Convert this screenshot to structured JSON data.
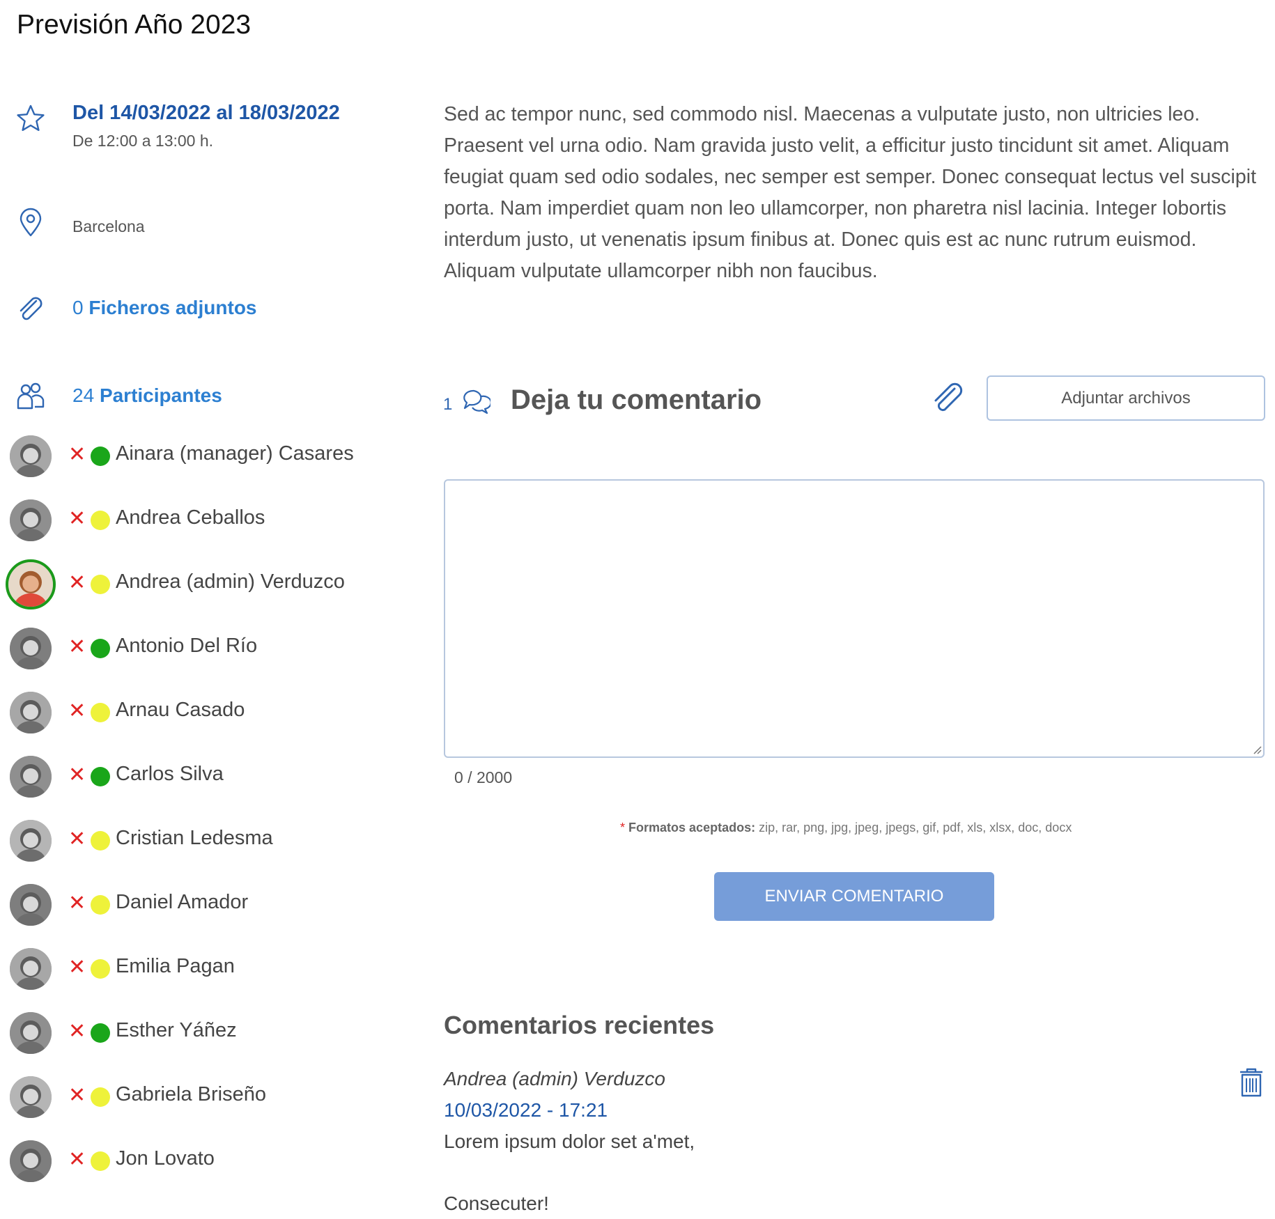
{
  "page": {
    "title": "Previsión Año 2023"
  },
  "event": {
    "date_range": "Del 14/03/2022 al 18/03/2022",
    "time_range": "De 12:00 a 13:00 h.",
    "location": "Barcelona",
    "attachments_count": "0",
    "attachments_label": "Ficheros adjuntos",
    "participants_count": "24",
    "participants_label": "Participantes",
    "description": "Sed ac tempor nunc, sed commodo nisl. Maecenas a vulputate justo, non ultricies leo. Praesent vel urna odio. Nam gravida justo velit, a efficitur justo tincidunt sit amet. Aliquam feugiat quam sed odio sodales, nec semper est semper. Donec consequat lectus vel suscipit porta. Nam imperdiet quam non leo ullamcorper, non pharetra nisl lacinia. Integer lobortis interdum justo, ut venenatis ipsum finibus at. Donec quis est ac nunc rutrum euismod. Aliquam vulputate ullamcorper nibh non faucibus."
  },
  "icons": {
    "date": "star-icon",
    "location": "map-pin-icon",
    "attachments": "paperclip-icon",
    "participants": "users-icon",
    "remove": "close-icon",
    "comments": "chat-bubbles-icon",
    "delete": "trash-icon"
  },
  "colors": {
    "status_confirmed": "#1aa61a",
    "status_pending": "#eef23a",
    "remove": "#e02424",
    "link": "#2c7fd1",
    "date": "#1e56a6",
    "send_button": "#769dd9",
    "current_user_ring": "#1b9a1b"
  },
  "participants": [
    {
      "name": "Ainara (manager) Casares",
      "status": "confirmed"
    },
    {
      "name": "Andrea Ceballos",
      "status": "pending"
    },
    {
      "name": "Andrea (admin) Verduzco",
      "status": "pending",
      "current_user": true
    },
    {
      "name": "Antonio Del Río",
      "status": "confirmed"
    },
    {
      "name": "Arnau Casado",
      "status": "pending"
    },
    {
      "name": "Carlos Silva",
      "status": "confirmed"
    },
    {
      "name": "Cristian Ledesma",
      "status": "pending"
    },
    {
      "name": "Daniel Amador",
      "status": "pending"
    },
    {
      "name": "Emilia Pagan",
      "status": "pending"
    },
    {
      "name": "Esther Yáñez",
      "status": "confirmed"
    },
    {
      "name": "Gabriela Briseño",
      "status": "pending"
    },
    {
      "name": "Jon Lovato",
      "status": "pending"
    }
  ],
  "comment_form": {
    "count": "1",
    "heading": "Deja tu comentario",
    "attach_button": "Adjuntar archivos",
    "textarea_value": "",
    "char_counter": "0 / 2000",
    "formats_asterisk": "*",
    "formats_label": "Formatos aceptados:",
    "formats_list": "zip, rar, png, jpg, jpeg, jpegs, gif, pdf, xls, xlsx, doc, docx",
    "send_button": "ENVIAR COMENTARIO"
  },
  "recent_comments": {
    "heading": "Comentarios recientes",
    "items": [
      {
        "author": "Andrea (admin) Verduzco",
        "date": "10/03/2022 - 17:21",
        "lines": [
          "Lorem ipsum dolor set a'met,",
          "Consecuter!"
        ]
      }
    ]
  }
}
